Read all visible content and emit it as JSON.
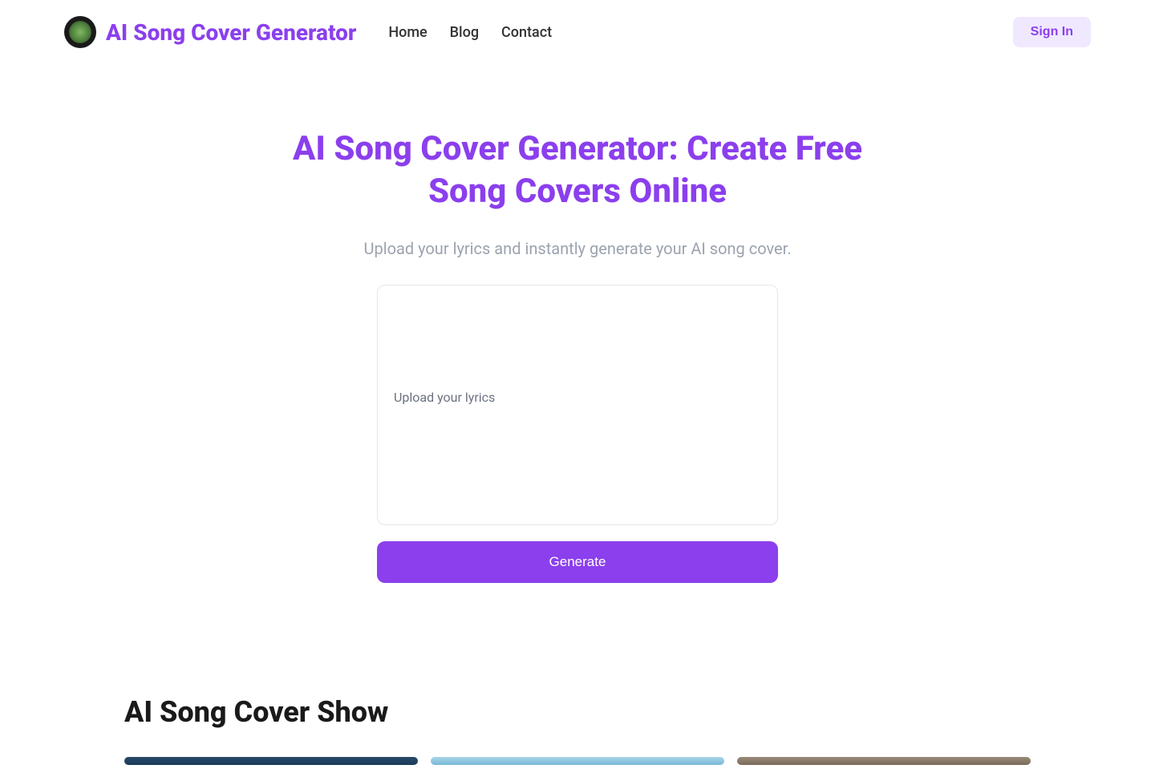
{
  "header": {
    "brand_name": "AI Song Cover Generator",
    "nav": {
      "home": "Home",
      "blog": "Blog",
      "contact": "Contact"
    },
    "sign_in": "Sign In"
  },
  "hero": {
    "title": "AI Song Cover Generator: Create Free Song Covers Online",
    "subtitle": "Upload your lyrics and instantly generate your AI song cover.",
    "input_placeholder": "Upload your lyrics",
    "generate_button": "Generate"
  },
  "showcase": {
    "title": "AI Song Cover Show"
  },
  "colors": {
    "primary": "#8b3fed",
    "primary_light": "#f0e8ff",
    "text_muted": "#9ca3af"
  }
}
